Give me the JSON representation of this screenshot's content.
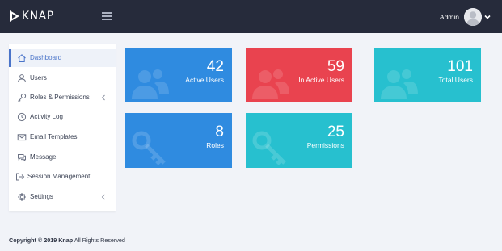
{
  "header": {
    "logo_text": "KNAP",
    "user_name": "Admin"
  },
  "sidebar": {
    "items": [
      {
        "label": "Dashboard",
        "icon": "home-icon",
        "active": true
      },
      {
        "label": "Users",
        "icon": "user-icon"
      },
      {
        "label": "Roles & Permissions",
        "icon": "key-icon",
        "has_submenu": true
      },
      {
        "label": "Activity Log",
        "icon": "clock-icon"
      },
      {
        "label": "Email Templates",
        "icon": "mail-icon"
      },
      {
        "label": "Message",
        "icon": "chat-icon"
      },
      {
        "label": "Session Management",
        "icon": "sign-out-icon"
      },
      {
        "label": "Settings",
        "icon": "gear-icon",
        "has_submenu": true
      }
    ]
  },
  "cards": [
    {
      "value": "42",
      "label": "Active Users",
      "color": "#2f8be0",
      "icon": "users-icon"
    },
    {
      "value": "59",
      "label": "In Active Users",
      "color": "#e9434f",
      "icon": "users-icon"
    },
    {
      "value": "101",
      "label": "Total Users",
      "color": "#27c0cf",
      "icon": "users-icon"
    },
    {
      "value": "8",
      "label": "Roles",
      "color": "#2f8be0",
      "icon": "key-icon"
    },
    {
      "value": "25",
      "label": "Permissions",
      "color": "#27c0cf",
      "icon": "key-icon"
    }
  ],
  "footer": {
    "copyright": "Copyright © 2019 Knap",
    "rights": " All Rights Reserved"
  },
  "colors": {
    "topbar": "#262b3b",
    "accent": "#4a74c9",
    "blue": "#2f8be0",
    "red": "#e9434f",
    "teal": "#27c0cf"
  }
}
